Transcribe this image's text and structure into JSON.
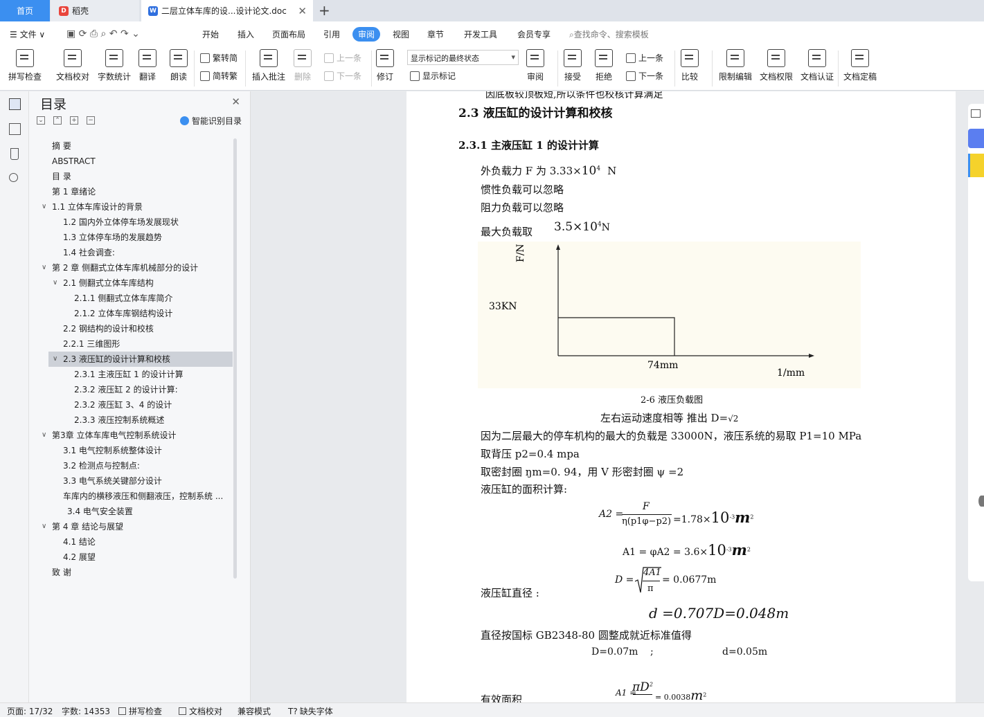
{
  "tabs": {
    "home": "首页",
    "daoke": "稻壳",
    "doc": "二层立体车库的设...设计论文.doc"
  },
  "menu": {
    "file": "文件",
    "items": [
      "开始",
      "插入",
      "页面布局",
      "引用",
      "审阅",
      "视图",
      "章节",
      "开发工具",
      "会员专享"
    ],
    "active": "审阅",
    "search": "查找命令、搜索模板"
  },
  "ribbon": {
    "spell": "拼写检查",
    "proof": "文档校对",
    "wordcount": "字数统计",
    "translate": "翻译",
    "read": "朗读",
    "trad": "繁转简",
    "simp": "简转繁",
    "comment": "插入批注",
    "delete": "删除",
    "prev": "上一条",
    "next": "下一条",
    "track": "修订",
    "markup_state": "显示标记的最终状态",
    "show_markup": "显示标记",
    "review": "审阅",
    "accept": "接受",
    "reject": "拒绝",
    "prev2": "上一条",
    "next2": "下一条",
    "compare": "比较",
    "restrict": "限制编辑",
    "perm": "文档权限",
    "auth": "文档认证",
    "final": "文档定稿"
  },
  "toc": {
    "title": "目录",
    "smart": "智能识别目录",
    "items": [
      {
        "label": "摘  要",
        "level": 0
      },
      {
        "label": "ABSTRACT",
        "level": 0
      },
      {
        "label": "目   录",
        "level": 0
      },
      {
        "label": "第 1 章绪论",
        "level": 0
      },
      {
        "label": "1.1  立体车库设计的背景",
        "level": 0,
        "exp": true
      },
      {
        "label": "1.2  国内外立体停车场发展现状",
        "level": 1
      },
      {
        "label": "1.3  立体停车场的发展趋势",
        "level": 1
      },
      {
        "label": "1.4  社会调查:",
        "level": 1
      },
      {
        "label": "第 2 章  侧翻式立体车库机械部分的设计",
        "level": 0,
        "exp": true
      },
      {
        "label": "2.1  侧翻式立体车库结构",
        "level": 1,
        "exp": true
      },
      {
        "label": "2.1.1  侧翻式立体车库简介",
        "level": 2
      },
      {
        "label": "2.1.2    立体车库钢结构设计",
        "level": 2
      },
      {
        "label": "2.2  钢结构的设计和校核",
        "level": 1
      },
      {
        "label": "2.2.1  三维图形",
        "level": 1
      },
      {
        "label": "2.3  液压缸的设计计算和校核",
        "level": 1,
        "exp": true,
        "sel": true
      },
      {
        "label": "2.3.1 主液压缸 1 的设计计算",
        "level": 2
      },
      {
        "label": "2.3.2 液压缸 2 的设计计算:",
        "level": 2
      },
      {
        "label": "2.3.2  液压缸 3、4 的设计",
        "level": 2
      },
      {
        "label": "2.3.3  液压控制系统概述",
        "level": 2
      },
      {
        "label": "第3章  立体车库电气控制系统设计",
        "level": 0,
        "exp": true
      },
      {
        "label": "3.1  电气控制系统整体设计",
        "level": 1
      },
      {
        "label": "3.2  检测点与控制点:",
        "level": 1
      },
      {
        "label": "3.3  电气系统关键部分设计",
        "level": 1
      },
      {
        "label": "车库内的横移液压和侧翻液压，控制系统 ...",
        "level": 1
      },
      {
        "label": "3.4  电气安全装置",
        "level": 1.4
      },
      {
        "label": "第 4 章  结论与展望",
        "level": 0,
        "exp": true
      },
      {
        "label": "4.1    结论",
        "level": 1
      },
      {
        "label": "4.2    展望",
        "level": 1
      },
      {
        "label": "致    谢",
        "level": 0
      }
    ]
  },
  "doc": {
    "cut_top": "因底板较顶板短,所以条件也校核计算满足",
    "h2": "2.3  液压缸的设计计算和校核",
    "h3": "2.3.1 主液压缸 1 的设计计算",
    "l1a": "外负载力 F 为 3.33×",
    "l1b": "10",
    "l1c": "4",
    "l1d": "N",
    "l2": "惯性负载可以忽略",
    "l3": "阻力负载可以忽略",
    "l4": "最大负载取",
    "l4b": "3.5×10",
    "l4c": "4",
    "l4d": "N",
    "chart_ylabel": "F/N",
    "chart_33": "33KN",
    "chart_74": "74mm",
    "chart_xlabel": "1/mm",
    "caption": "2-6  液压负载图",
    "speed": "左右运动速度相等  推出 D=",
    "sqrt2": "√2",
    "p1": "因为二层最大的停车机构的最大的负载是 33000N，液压系统的易取 P1=10 MPa",
    "p2": "取背压 p2=0.4 mpa",
    "p3": "取密封圈 ŋm=0. 94，用 V 形密封圈 ψ =2",
    "p4": "液压缸的面积计算:",
    "f1": "A2 = F / η(p1φ−p2) = 1.78×10⁻³ m²",
    "f1a": "A2 =",
    "f1F": "F",
    "f1den": "η(p1φ−p2)",
    "f1r": "=1.78×",
    "f1t": "10",
    "f1e": "-3",
    "f1m": "m",
    "f1s": "2",
    "f2a": "A1 = φA2 = 3.6×",
    "f2t": "10",
    "f2e": "-3",
    "f2m": "m",
    "f2s": "2",
    "dia_label": "液压缸直径  :",
    "f3a": "D =",
    "f3num": "4A1",
    "f3den": "π",
    "f3r": "= 0.0677m",
    "f4": "d =0.707D=0.048m",
    "p5": "直径按国标 GB2348-80 圆整成就近标准值得",
    "p6a": "D=0.07m",
    "p6b": ";",
    "p6c": "d=0.05m",
    "f5a": "A1 =",
    "f5num": "πD",
    "f5e": "2",
    "f5r": "= 0.0038",
    "f5m": "m",
    "f5s": "2",
    "cut_bottom": "有效面积"
  },
  "status": {
    "page": "页面: 17/32",
    "words": "字数: 14353",
    "spell": "拼写检查",
    "proof": "文档校对",
    "compat": "兼容模式",
    "font": "缺失字体"
  }
}
